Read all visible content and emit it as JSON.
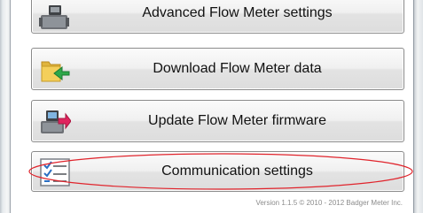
{
  "buttons": {
    "advanced": {
      "label": "Advanced Flow Meter settings",
      "icon": "flow-meter-icon"
    },
    "download": {
      "label": "Download Flow Meter data",
      "icon": "folder-arrow-icon"
    },
    "update": {
      "label": "Update Flow Meter firmware",
      "icon": "flow-meter-update-icon"
    },
    "communication": {
      "label": "Communication settings",
      "icon": "checklist-icon"
    }
  },
  "version_text": "Version 1.1.5 © 2010 - 2012 Badger Meter Inc.",
  "colors": {
    "highlight_ellipse": "#e0242c",
    "button_border": "#8a8a8a",
    "version_text": "#8c8c8c"
  }
}
